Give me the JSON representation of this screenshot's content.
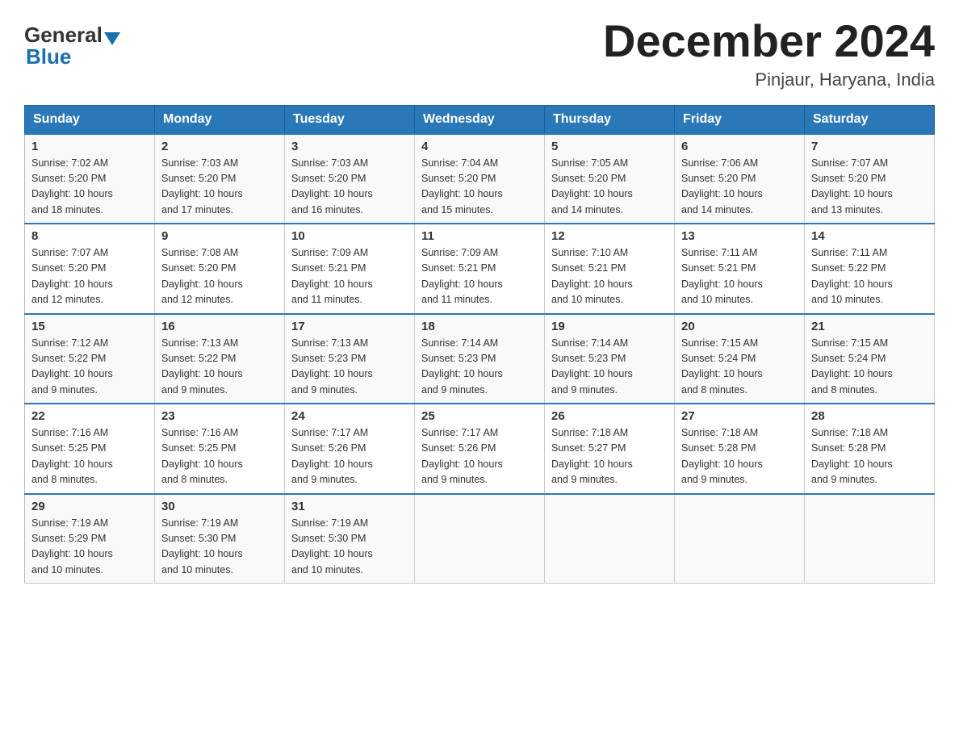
{
  "header": {
    "logo_general": "General",
    "logo_blue": "Blue",
    "month_title": "December 2024",
    "location": "Pinjaur, Haryana, India"
  },
  "days_of_week": [
    "Sunday",
    "Monday",
    "Tuesday",
    "Wednesday",
    "Thursday",
    "Friday",
    "Saturday"
  ],
  "weeks": [
    [
      {
        "day": "1",
        "sunrise": "7:02 AM",
        "sunset": "5:20 PM",
        "daylight": "10 hours and 18 minutes."
      },
      {
        "day": "2",
        "sunrise": "7:03 AM",
        "sunset": "5:20 PM",
        "daylight": "10 hours and 17 minutes."
      },
      {
        "day": "3",
        "sunrise": "7:03 AM",
        "sunset": "5:20 PM",
        "daylight": "10 hours and 16 minutes."
      },
      {
        "day": "4",
        "sunrise": "7:04 AM",
        "sunset": "5:20 PM",
        "daylight": "10 hours and 15 minutes."
      },
      {
        "day": "5",
        "sunrise": "7:05 AM",
        "sunset": "5:20 PM",
        "daylight": "10 hours and 14 minutes."
      },
      {
        "day": "6",
        "sunrise": "7:06 AM",
        "sunset": "5:20 PM",
        "daylight": "10 hours and 14 minutes."
      },
      {
        "day": "7",
        "sunrise": "7:07 AM",
        "sunset": "5:20 PM",
        "daylight": "10 hours and 13 minutes."
      }
    ],
    [
      {
        "day": "8",
        "sunrise": "7:07 AM",
        "sunset": "5:20 PM",
        "daylight": "10 hours and 12 minutes."
      },
      {
        "day": "9",
        "sunrise": "7:08 AM",
        "sunset": "5:20 PM",
        "daylight": "10 hours and 12 minutes."
      },
      {
        "day": "10",
        "sunrise": "7:09 AM",
        "sunset": "5:21 PM",
        "daylight": "10 hours and 11 minutes."
      },
      {
        "day": "11",
        "sunrise": "7:09 AM",
        "sunset": "5:21 PM",
        "daylight": "10 hours and 11 minutes."
      },
      {
        "day": "12",
        "sunrise": "7:10 AM",
        "sunset": "5:21 PM",
        "daylight": "10 hours and 10 minutes."
      },
      {
        "day": "13",
        "sunrise": "7:11 AM",
        "sunset": "5:21 PM",
        "daylight": "10 hours and 10 minutes."
      },
      {
        "day": "14",
        "sunrise": "7:11 AM",
        "sunset": "5:22 PM",
        "daylight": "10 hours and 10 minutes."
      }
    ],
    [
      {
        "day": "15",
        "sunrise": "7:12 AM",
        "sunset": "5:22 PM",
        "daylight": "10 hours and 9 minutes."
      },
      {
        "day": "16",
        "sunrise": "7:13 AM",
        "sunset": "5:22 PM",
        "daylight": "10 hours and 9 minutes."
      },
      {
        "day": "17",
        "sunrise": "7:13 AM",
        "sunset": "5:23 PM",
        "daylight": "10 hours and 9 minutes."
      },
      {
        "day": "18",
        "sunrise": "7:14 AM",
        "sunset": "5:23 PM",
        "daylight": "10 hours and 9 minutes."
      },
      {
        "day": "19",
        "sunrise": "7:14 AM",
        "sunset": "5:23 PM",
        "daylight": "10 hours and 9 minutes."
      },
      {
        "day": "20",
        "sunrise": "7:15 AM",
        "sunset": "5:24 PM",
        "daylight": "10 hours and 8 minutes."
      },
      {
        "day": "21",
        "sunrise": "7:15 AM",
        "sunset": "5:24 PM",
        "daylight": "10 hours and 8 minutes."
      }
    ],
    [
      {
        "day": "22",
        "sunrise": "7:16 AM",
        "sunset": "5:25 PM",
        "daylight": "10 hours and 8 minutes."
      },
      {
        "day": "23",
        "sunrise": "7:16 AM",
        "sunset": "5:25 PM",
        "daylight": "10 hours and 8 minutes."
      },
      {
        "day": "24",
        "sunrise": "7:17 AM",
        "sunset": "5:26 PM",
        "daylight": "10 hours and 9 minutes."
      },
      {
        "day": "25",
        "sunrise": "7:17 AM",
        "sunset": "5:26 PM",
        "daylight": "10 hours and 9 minutes."
      },
      {
        "day": "26",
        "sunrise": "7:18 AM",
        "sunset": "5:27 PM",
        "daylight": "10 hours and 9 minutes."
      },
      {
        "day": "27",
        "sunrise": "7:18 AM",
        "sunset": "5:28 PM",
        "daylight": "10 hours and 9 minutes."
      },
      {
        "day": "28",
        "sunrise": "7:18 AM",
        "sunset": "5:28 PM",
        "daylight": "10 hours and 9 minutes."
      }
    ],
    [
      {
        "day": "29",
        "sunrise": "7:19 AM",
        "sunset": "5:29 PM",
        "daylight": "10 hours and 10 minutes."
      },
      {
        "day": "30",
        "sunrise": "7:19 AM",
        "sunset": "5:30 PM",
        "daylight": "10 hours and 10 minutes."
      },
      {
        "day": "31",
        "sunrise": "7:19 AM",
        "sunset": "5:30 PM",
        "daylight": "10 hours and 10 minutes."
      },
      null,
      null,
      null,
      null
    ]
  ],
  "labels": {
    "sunrise": "Sunrise:",
    "sunset": "Sunset:",
    "daylight": "Daylight:"
  }
}
